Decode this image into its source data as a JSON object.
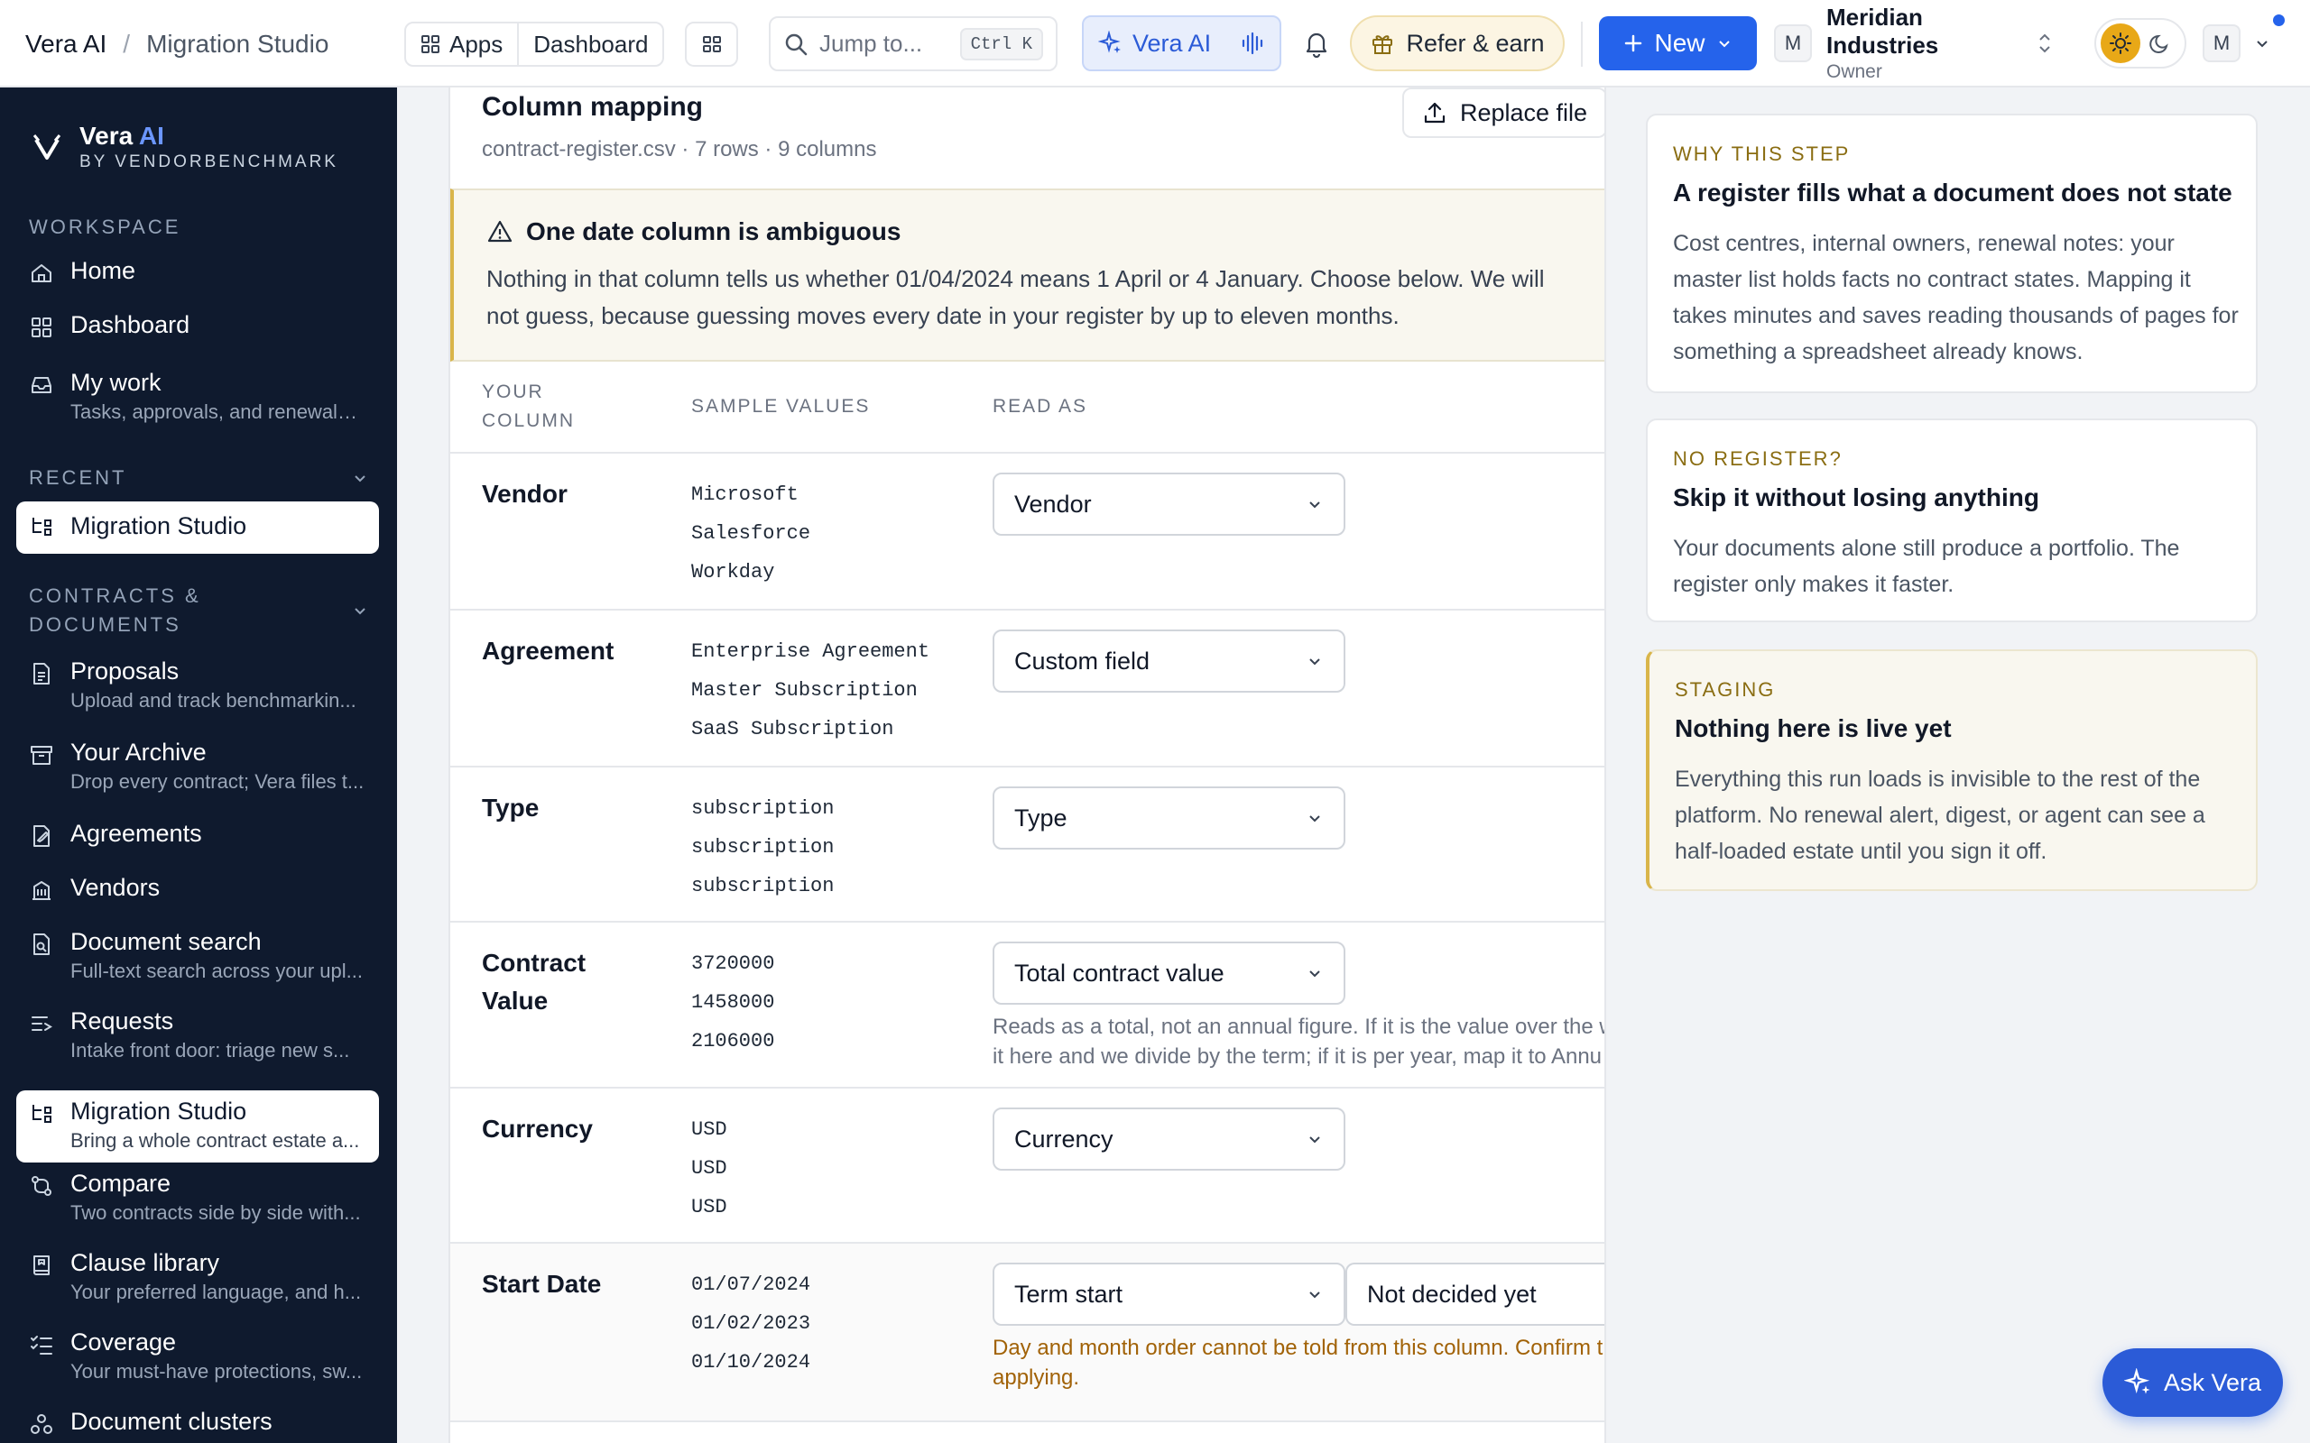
{
  "header": {
    "breadcrumb_root": "Vera AI",
    "breadcrumb_sep": "/",
    "breadcrumb_page": "Migration Studio",
    "apps_label": "Apps",
    "dashboard_label": "Dashboard",
    "search_placeholder": "Jump to...",
    "search_shortcut": "Ctrl K",
    "vera_label": "Vera AI",
    "refer_label": "Refer & earn",
    "new_label": "New",
    "org_initial": "M",
    "org_name": "Meridian Industries",
    "org_role": "Owner",
    "user_initial": "M"
  },
  "sidebar": {
    "brand_name": "Vera",
    "brand_ai": "AI",
    "brand_sub": "BY VENDORBENCHMARK",
    "workspace_label": "WORKSPACE",
    "recent_label": "RECENT",
    "contracts_label_1": "CONTRACTS &",
    "contracts_label_2": "DOCUMENTS",
    "workspace_items": [
      {
        "label": "Home",
        "icon": "home-icon"
      },
      {
        "label": "Dashboard",
        "icon": "dashboard-icon"
      },
      {
        "label": "My work",
        "sub": "Tasks, approvals, and renewals ...",
        "icon": "inbox-icon"
      }
    ],
    "recent_items": [
      {
        "label": "Migration Studio",
        "icon": "migration-icon"
      }
    ],
    "contract_items": [
      {
        "label": "Proposals",
        "sub": "Upload and track benchmarkin...",
        "icon": "document-icon"
      },
      {
        "label": "Your Archive",
        "sub": "Drop every contract; Vera files t...",
        "icon": "archive-icon"
      },
      {
        "label": "Agreements",
        "icon": "agreement-icon"
      },
      {
        "label": "Vendors",
        "icon": "building-icon"
      },
      {
        "label": "Document search",
        "sub": "Full-text search across your upl...",
        "icon": "document-search-icon"
      },
      {
        "label": "Requests",
        "sub": "Intake front door: triage new s...",
        "icon": "requests-icon"
      },
      {
        "label": "Migration Studio",
        "sub": "Bring a whole contract estate a...",
        "icon": "migration-icon"
      },
      {
        "label": "Compare",
        "sub": "Two contracts side by side with...",
        "icon": "compare-icon"
      },
      {
        "label": "Clause library",
        "sub": "Your preferred language, and h...",
        "icon": "book-icon"
      },
      {
        "label": "Coverage",
        "sub": "Your must-have protections, sw...",
        "icon": "checklist-icon"
      },
      {
        "label": "Document clusters",
        "icon": "clusters-icon"
      }
    ]
  },
  "main": {
    "title": "Column mapping",
    "subtitle": "contract-register.csv · 7 rows · 9 columns",
    "replace_label": "Replace file",
    "warning_title": "One date column is ambiguous",
    "warning_body": "Nothing in that column tells us whether 01/04/2024 means 1 April or 4 January. Choose below. We will not guess, because guessing moves every date in your register by up to eleven months.",
    "col_your_1": "YOUR",
    "col_your_2": "COLUMN",
    "col_samples": "SAMPLE VALUES",
    "col_readas": "READ AS",
    "rows": [
      {
        "name": "Vendor",
        "samples": [
          "Microsoft",
          "Salesforce",
          "Workday"
        ],
        "read_as": "Vendor"
      },
      {
        "name": "Agreement",
        "samples": [
          "Enterprise Agreement",
          "Master Subscription",
          "SaaS Subscription"
        ],
        "read_as": "Custom field"
      },
      {
        "name": "Type",
        "samples": [
          "subscription",
          "subscription",
          "subscription"
        ],
        "read_as": "Type"
      },
      {
        "name": "Contract Value",
        "samples": [
          "3720000",
          "1458000",
          "2106000"
        ],
        "read_as": "Total contract value",
        "hint_1": "Reads as a total, not an annual figure. If it is the value over the w",
        "hint_2": "it here and we divide by the term; if it is per year, map it to Annu"
      },
      {
        "name": "Currency",
        "samples": [
          "USD",
          "USD",
          "USD"
        ],
        "read_as": "Currency"
      },
      {
        "name": "Start Date",
        "samples": [
          "01/07/2024",
          "01/02/2023",
          "01/10/2024"
        ],
        "read_as": "Term start",
        "date_format": "Not decided yet",
        "hint_1": "Day and month order cannot be told from this column. Confirm t",
        "hint_2": "applying."
      }
    ]
  },
  "right_panel": {
    "cards": [
      {
        "label": "WHY THIS STEP",
        "title": "A register fills what a document does not state",
        "body_lines": [
          "Cost centres, internal owners, renewal notes: your",
          "master list holds facts no contract states. Mapping it",
          "takes minutes and saves reading thousands of pages for",
          "something a spreadsheet already knows."
        ]
      },
      {
        "label": "NO REGISTER?",
        "title": "Skip it without losing anything",
        "body_lines": [
          "Your documents alone still produce a portfolio. The",
          "register only makes it faster."
        ]
      },
      {
        "label": "STAGING",
        "title": "Nothing here is live yet",
        "body_lines": [
          "Everything this run loads is invisible to the rest of the",
          "platform. No renewal alert, digest, or agent can see a",
          "half-loaded estate until you sign it off."
        ]
      }
    ]
  },
  "ask_label": "Ask Vera",
  "colors": {
    "accent": "#2563eb",
    "sidebar_bg": "#0f1a2e",
    "warning": "#d9b54a"
  }
}
